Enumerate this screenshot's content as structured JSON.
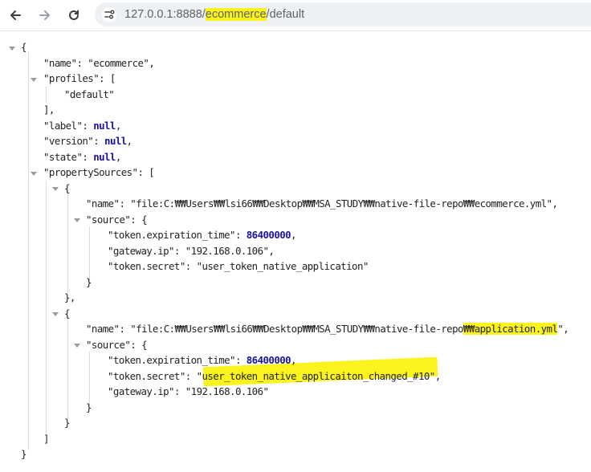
{
  "browser": {
    "url_host": "127.0.0.1:8888/",
    "url_path_highlight": "ecommerce",
    "url_path_rest": "/default"
  },
  "json": {
    "open_brace": "{",
    "close_brace": "}",
    "name_key": "\"name\"",
    "name_value": "\"ecommerce\"",
    "profiles_key": "\"profiles\"",
    "profiles_item": "\"default\"",
    "label_key": "\"label\"",
    "version_key": "\"version\"",
    "state_key": "\"state\"",
    "null_value": "null",
    "property_sources_key": "\"propertySources\"",
    "ps1_name_key": "\"name\"",
    "ps1_name_value": "\"file:C:₩₩Users₩₩lsi66₩₩Desktop₩₩MSA_STUDY₩₩native-file-repo₩₩ecommerce.yml\"",
    "ps1_source_key": "\"source\"",
    "ps1_token_exp_key": "\"token.expiration_time\"",
    "ps1_token_exp_value": "86400000",
    "ps1_gateway_key": "\"gateway.ip\"",
    "ps1_gateway_value": "\"192.168.0.106\"",
    "ps1_secret_key": "\"token.secret\"",
    "ps1_secret_value": "\"user_token_native_application\"",
    "ps2_name_key": "\"name\"",
    "ps2_name_value_prefix": "\"file:C:₩₩Users₩₩lsi66₩₩Desktop₩₩MSA_STUDY₩₩native-file-repo",
    "ps2_name_value_highlight": "₩₩application.yml",
    "ps2_name_value_suffix": "\"",
    "ps2_source_key": "\"source\"",
    "ps2_token_exp_key": "\"token.expiration_time\"",
    "ps2_token_exp_value": "86400000",
    "ps2_secret_key": "\"token.secret\"",
    "ps2_secret_value": "\"user_token_native_applicaiton_changed_#10\"",
    "ps2_gateway_key": "\"gateway.ip\"",
    "ps2_gateway_value": "\"192.168.0.106\""
  },
  "colors": {
    "highlight": "#fbf31e",
    "keyword": "#1a12a6"
  }
}
